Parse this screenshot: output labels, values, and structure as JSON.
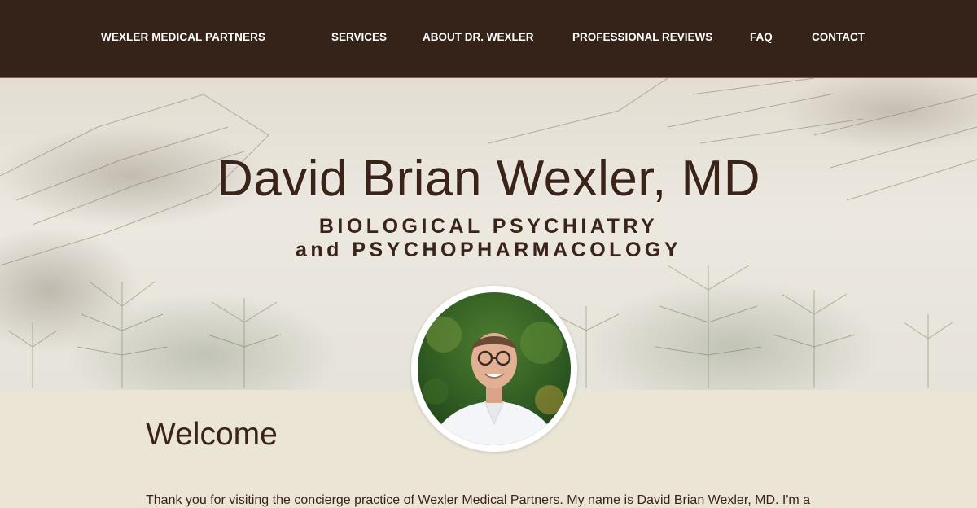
{
  "header": {
    "brand": "WEXLER MEDICAL PARTNERS",
    "nav": [
      {
        "label": "SERVICES"
      },
      {
        "label": "ABOUT DR. WEXLER"
      },
      {
        "label": "PROFESSIONAL REVIEWS"
      },
      {
        "label": "FAQ"
      },
      {
        "label": "CONTACT"
      }
    ]
  },
  "hero": {
    "title": "David Brian Wexler, MD",
    "subtitle_line1": "BIOLOGICAL PSYCHIATRY",
    "subtitle_line2": "and  PSYCHOPHARMACOLOGY"
  },
  "main": {
    "welcome_heading": "Welcome",
    "intro_text": "Thank you for visiting the concierge practice of Wexler Medical Partners. My name is David Brian Wexler, MD. I'm a"
  },
  "colors": {
    "header_bg": "#352218",
    "text_brown": "#3a2318",
    "content_bg": "#ebe5d6"
  }
}
